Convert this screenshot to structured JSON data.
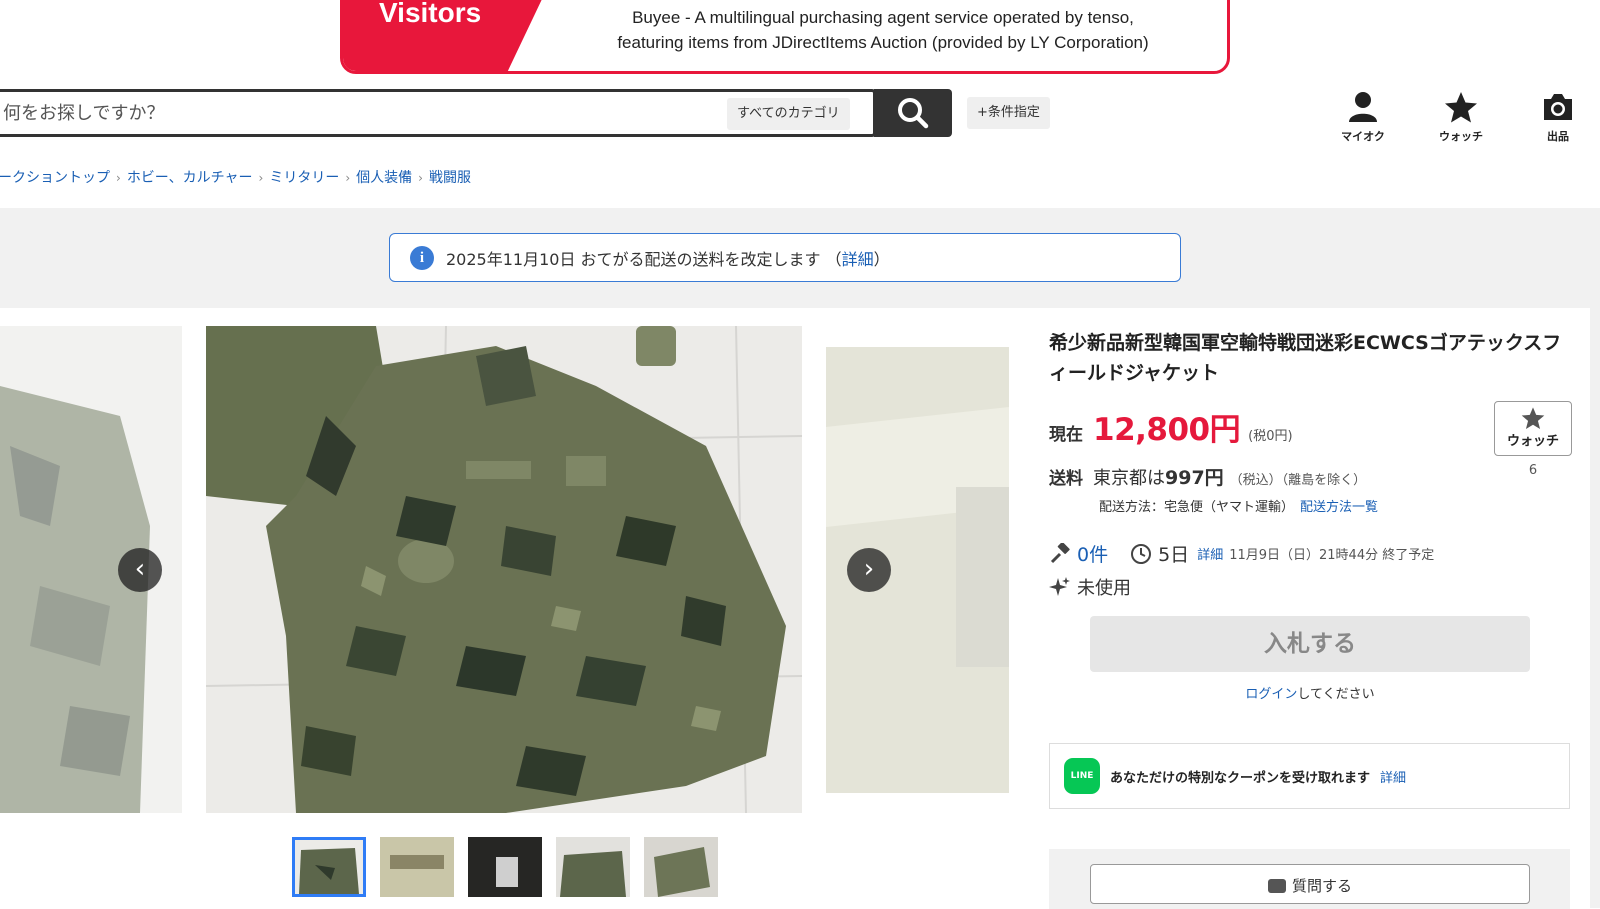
{
  "banner": {
    "heading": "Visitors",
    "line1": "Buyee - A multilingual purchasing agent service operated by tenso,",
    "line2": "featuring items from JDirectItems Auction (provided by LY Corporation)"
  },
  "search": {
    "placeholder": "何をお探しですか？",
    "category_label": "すべてのカテゴリ",
    "conditions_label": "+条件指定"
  },
  "nav_icons": [
    {
      "label": "マイオク",
      "icon": "user-icon"
    },
    {
      "label": "ウォッチ",
      "icon": "star-icon"
    },
    {
      "label": "出品",
      "icon": "camera-icon"
    }
  ],
  "breadcrumb": [
    "ークショントップ",
    "ホビー、カルチャー",
    "ミリタリー",
    "個人装備",
    "戦闘服"
  ],
  "notice": {
    "text": "2025年11月10日 おてがる配送の送料を改定します （",
    "link": "詳細",
    "close": "）"
  },
  "product": {
    "title": "希少新品新型韓国軍空輸特戦団迷彩ECWCSゴアテックスフィールドジャケット",
    "price_label": "現在",
    "price": "12,800円",
    "tax_note": "(税0円)",
    "watch_label": "ウォッチ",
    "watch_count": "6",
    "shipping_label": "送料",
    "shipping_prefix": "東京都は",
    "shipping_price": "997円",
    "shipping_tax": "（税込）（離島を除く）",
    "shipping_method": "配送方法：宅急便（ヤマト運輸）",
    "shipping_method_link": "配送方法一覧",
    "bids": "0件",
    "time_left": "5日",
    "time_detail_link": "詳細",
    "end_time": "11月9日（日）21時44分 終了予定",
    "condition": "未使用",
    "bid_button": "入札する",
    "login_link": "ログイン",
    "login_suffix": "してください",
    "coupon_text": "あなただけの特別なクーポンを受け取れます",
    "coupon_link": "詳細",
    "line_logo": "LINE",
    "question_button": "質問する"
  },
  "colors": {
    "accent_red": "#e5193c",
    "link_blue": "#1a5fb4",
    "notice_blue": "#3a7bd5",
    "line_green": "#06c755"
  }
}
